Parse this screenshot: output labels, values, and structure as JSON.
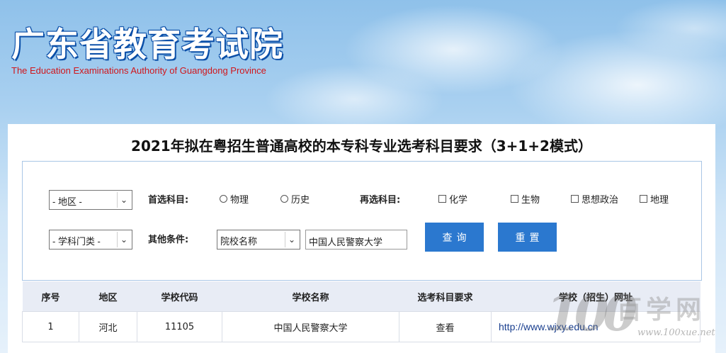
{
  "header": {
    "title": "广东省教育考试院",
    "subtitle": "The Education Examinations Authority of Guangdong Province"
  },
  "page_title": "2021年拟在粤招生普通高校的本专科专业选考科目要求（3+1+2模式）",
  "filters": {
    "region_select": "- 地区 -",
    "category_select": "- 学科门类 -",
    "first_subject_label": "首选科目:",
    "first_subjects": [
      "物理",
      "历史"
    ],
    "second_subject_label": "再选科目:",
    "second_subjects": [
      "化学",
      "生物",
      "思想政治",
      "地理"
    ],
    "other_label": "其他条件:",
    "other_select": "院校名称",
    "search_value": "中国人民警察大学",
    "query_button": "查询",
    "reset_button": "重置"
  },
  "table": {
    "headers": [
      "序号",
      "地区",
      "学校代码",
      "学校名称",
      "选考科目要求",
      "学校（招生）网址"
    ],
    "rows": [
      [
        "1",
        "河北",
        "11105",
        "中国人民警察大学",
        "查看",
        "http://www.wjxy.edu.cn"
      ]
    ]
  },
  "watermark": {
    "number": "100",
    "text": "百学网",
    "url": "www.100xue.net"
  }
}
